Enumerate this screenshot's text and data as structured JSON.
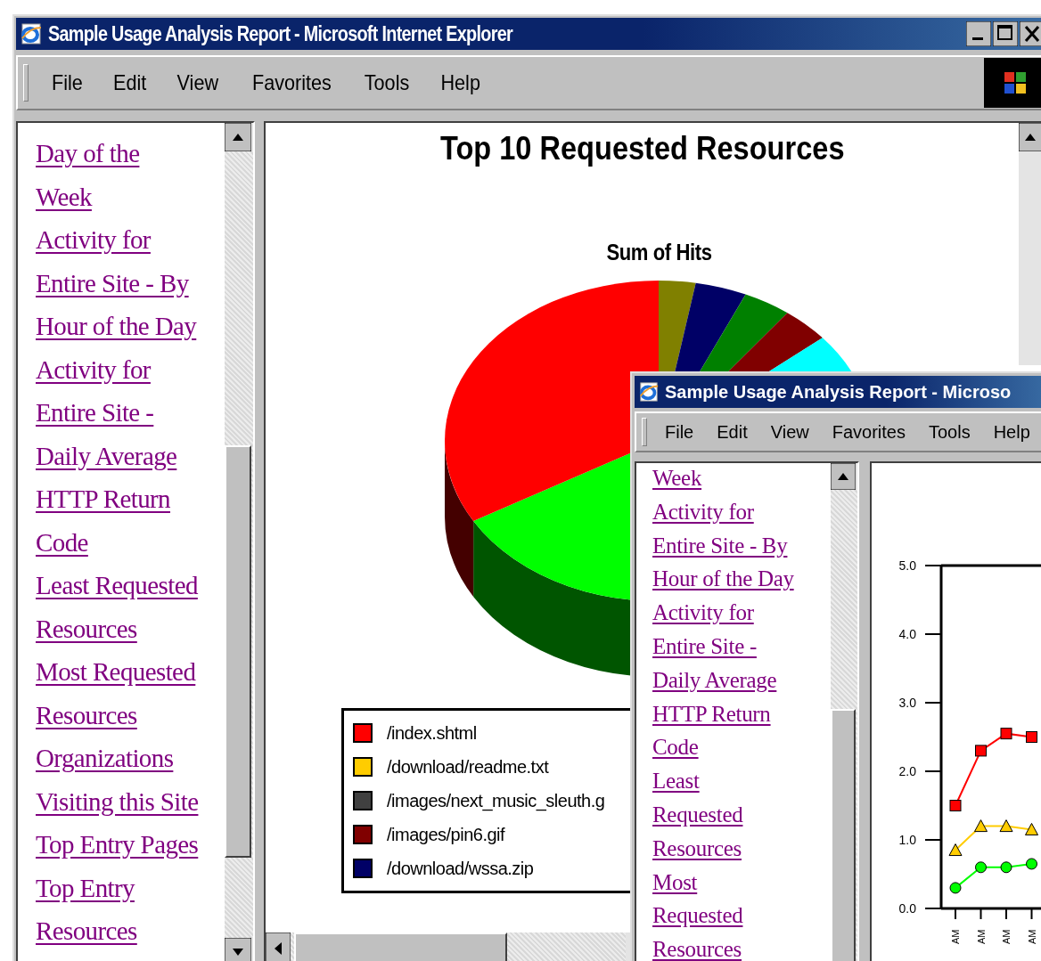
{
  "window": {
    "title": "Sample Usage Analysis Report - Microsoft Internet Explorer",
    "menu": [
      "File",
      "Edit",
      "View",
      "Favorites",
      "Tools",
      "Help"
    ]
  },
  "nav_links": [
    {
      "lines": [
        "Day of the",
        "Week"
      ]
    },
    {
      "lines": [
        "Activity for",
        "Entire Site - By",
        "Hour of the Day"
      ]
    },
    {
      "lines": [
        "Activity for",
        "Entire Site -",
        "Daily Average"
      ]
    },
    {
      "lines": [
        "HTTP Return",
        "Code"
      ]
    },
    {
      "lines": [
        "Least Requested",
        "Resources"
      ]
    },
    {
      "lines": [
        "Most Requested",
        "Resources"
      ]
    },
    {
      "lines": [
        "Organizations",
        "Visiting this Site"
      ]
    },
    {
      "lines": [
        "Top Entry Pages"
      ]
    },
    {
      "lines": [
        "Top Entry",
        "Resources"
      ]
    }
  ],
  "report": {
    "title": "Top 10 Requested Resources",
    "chart_title": "Sum of Hits",
    "legend": [
      {
        "label": "/index.shtml",
        "color": "#ff0000"
      },
      {
        "label": "/download/readme.txt",
        "color": "#ffcc00"
      },
      {
        "label": "/images/next_music_sleuth.g",
        "color": "#404040"
      },
      {
        "label": "/images/pin6.gif",
        "color": "#800000"
      },
      {
        "label": "/download/wssa.zip",
        "color": "#000066"
      }
    ]
  },
  "second_window": {
    "title": "Sample Usage Analysis Report - Microso",
    "menu": [
      "File",
      "Edit",
      "View",
      "Favorites",
      "Tools",
      "Help"
    ],
    "nav_links": [
      {
        "lines": [
          "Week"
        ]
      },
      {
        "lines": [
          "Activity for",
          "Entire Site - By",
          "Hour of the Day"
        ]
      },
      {
        "lines": [
          "Activity for",
          "Entire Site -",
          "Daily Average"
        ]
      },
      {
        "lines": [
          "HTTP Return",
          "Code"
        ]
      },
      {
        "lines": [
          "Least",
          "Requested",
          "Resources"
        ]
      },
      {
        "lines": [
          "Most",
          "Requested",
          "Resources"
        ]
      }
    ],
    "chart_data": {
      "type": "line",
      "categories": [
        "AM",
        "AM",
        "AM",
        "AM"
      ],
      "ylim": [
        0,
        5
      ],
      "yticks": [
        {
          "value": 0,
          "label": "0.0"
        },
        {
          "value": 1,
          "label": "1.0"
        },
        {
          "value": 2,
          "label": "2.0"
        },
        {
          "value": 3,
          "label": "3.0"
        },
        {
          "value": 4,
          "label": "4.0"
        },
        {
          "value": 5,
          "label": "5.0"
        }
      ],
      "series": [
        {
          "color": "#ff0000",
          "marker": "square",
          "values": [
            1.5,
            2.3,
            2.55,
            2.5
          ]
        },
        {
          "color": "#ffcc00",
          "marker": "triangle",
          "values": [
            0.85,
            1.2,
            1.2,
            1.15
          ]
        },
        {
          "color": "#00ff00",
          "marker": "circle",
          "values": [
            0.3,
            0.6,
            0.6,
            0.65
          ]
        }
      ]
    }
  }
}
